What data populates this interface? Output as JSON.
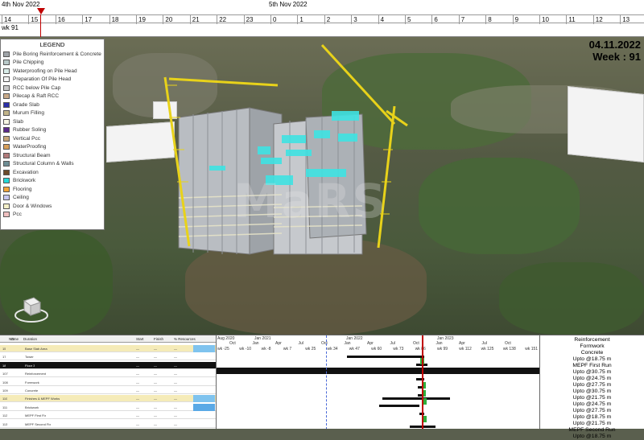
{
  "timeline": {
    "left_date": "4th Nov 2022",
    "right_date": "5th Nov 2022",
    "week": "wk 91",
    "left_hours": [
      "14",
      "15",
      "16",
      "17",
      "18",
      "19",
      "20",
      "21",
      "22",
      "23"
    ],
    "right_hours": [
      "0",
      "1",
      "2",
      "3",
      "4",
      "5",
      "6",
      "7",
      "8",
      "9",
      "10",
      "11",
      "12",
      "13"
    ]
  },
  "stamp": {
    "date": "04.11.2022",
    "week": "Week : 91"
  },
  "legend": {
    "title": "LEGEND",
    "items": [
      {
        "label": "Pile Boring Reinforcement & Concrete",
        "color": "#9fa4a8"
      },
      {
        "label": "Pile Chipping",
        "color": "#b9c9c9"
      },
      {
        "label": "Waterproofing on Pile Head",
        "color": "#d8ece8"
      },
      {
        "label": "Preparation Of Pile Head",
        "color": "#f4f4f4"
      },
      {
        "label": "RCC below Pile Cap",
        "color": "#c9c9c9"
      },
      {
        "label": "Pilecap & Raft RCC",
        "color": "#c8a987"
      },
      {
        "label": "Grade Slab",
        "color": "#2b2fa8"
      },
      {
        "label": "Murum Filling",
        "color": "#c2b58a"
      },
      {
        "label": "Slab",
        "color": "#f7f7e4"
      },
      {
        "label": "Rubber Soling",
        "color": "#5b2a8a"
      },
      {
        "label": "Vertical Pcc",
        "color": "#c7a678"
      },
      {
        "label": "WaterProofing",
        "color": "#d8a05a"
      },
      {
        "label": "Structural Beam",
        "color": "#b17b7b"
      },
      {
        "label": "Structural Column & Walls",
        "color": "#6d8d94"
      },
      {
        "label": "Excavation",
        "color": "#6b4a2a"
      },
      {
        "label": "Brickwork",
        "color": "#23d7d7"
      },
      {
        "label": "Flooring",
        "color": "#f2a53a"
      },
      {
        "label": "Ceiling",
        "color": "#c7c7f0"
      },
      {
        "label": "Door & Windows",
        "color": "#f4f0c8"
      },
      {
        "label": "Pcc",
        "color": "#f0c0c0"
      }
    ]
  },
  "watermark": "MaRS",
  "gantt": {
    "headers": [
      "ID",
      "Name",
      "Duration",
      "Start",
      "Finish",
      "% Resources"
    ],
    "years": [
      "Aug 2020",
      "Jan 2021",
      "Jan 2022",
      "Jan 2023"
    ],
    "months": [
      "Oct",
      "Jan",
      "Apr",
      "Jul",
      "Oct",
      "Jan",
      "Apr",
      "Jul",
      "Oct",
      "Jan",
      "Apr",
      "Jul",
      "Oct"
    ],
    "weeks": [
      "wk -25",
      "wk -10",
      "wk -8",
      "wk 7",
      "wk 25",
      "wk 34",
      "wk 47",
      "wk 60",
      "wk 73",
      "wk 86",
      "wk 99",
      "wk 112",
      "wk 125",
      "wk 138",
      "wk 151"
    ],
    "rows": [
      {
        "id": "15",
        "name": "Base Slab Area",
        "dur": "—",
        "start": "—",
        "finish": "—",
        "style": "sum"
      },
      {
        "id": "17",
        "name": "Tower",
        "dur": "—",
        "start": "—",
        "finish": "—",
        "style": "plain"
      },
      {
        "id": "18",
        "name": "Floor 3",
        "dur": "—",
        "start": "—",
        "finish": "—",
        "style": "dark"
      },
      {
        "id": "107",
        "name": "Reinforcement",
        "dur": "—",
        "start": "—",
        "finish": "—",
        "style": "plain"
      },
      {
        "id": "108",
        "name": "Formwork",
        "dur": "—",
        "start": "—",
        "finish": "—",
        "style": "plain"
      },
      {
        "id": "109",
        "name": "Concrete",
        "dur": "—",
        "start": "—",
        "finish": "—",
        "style": "plain"
      },
      {
        "id": "110",
        "name": "Finishes & MEPF Works",
        "dur": "—",
        "start": "—",
        "finish": "—",
        "style": "sum"
      },
      {
        "id": "111",
        "name": "Brickwork",
        "dur": "—",
        "start": "—",
        "finish": "—",
        "style": "blue"
      },
      {
        "id": "112",
        "name": "MEPF First Fix",
        "dur": "—",
        "start": "—",
        "finish": "—",
        "style": "plain"
      },
      {
        "id": "113",
        "name": "MEPF Second Fix",
        "dur": "—",
        "start": "—",
        "finish": "—",
        "style": "plain"
      }
    ]
  },
  "status_panel": {
    "lines": [
      "Reinforcement",
      "Formwork",
      "Concrete",
      "Upto @18.75 m",
      "MEPF First Run",
      "Upto @30.75 m",
      "Upto @24.75 m",
      "Upto @27.75 m",
      "Upto @30.75 m",
      "Upto @21.75 m",
      "Upto @24.75 m",
      "Upto @27.75 m",
      "Upto @18.75 m",
      "Upto @21.75 m",
      "MEPF Second Run",
      "Upto @18.75 m"
    ]
  },
  "colors": {
    "playhead": "#c00000",
    "crane": "#e8d21a",
    "highlight": "#3fe3e3"
  }
}
